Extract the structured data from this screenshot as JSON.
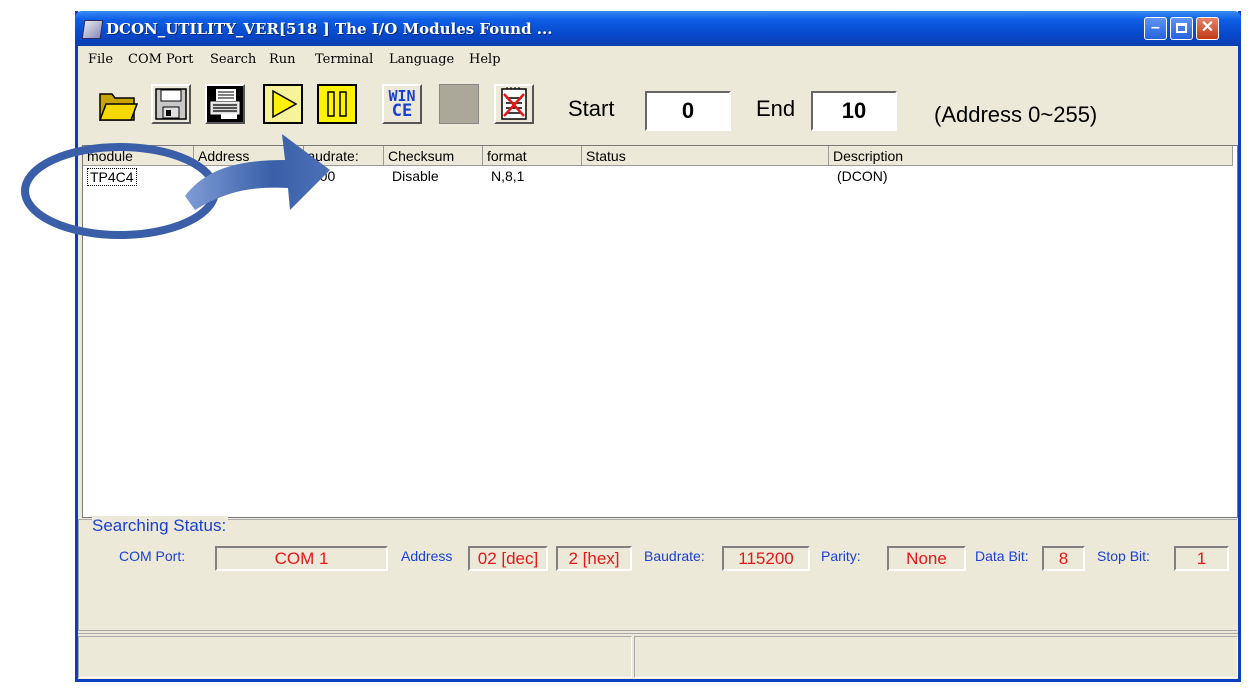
{
  "window": {
    "title": "DCON_UTILITY_VER[518 ] The I/O Modules Found ..."
  },
  "menu": [
    "File",
    "COM Port",
    "Search",
    "Run",
    "Terminal",
    "Language",
    "Help"
  ],
  "toolbar": {
    "start_label": "Start",
    "start_value": "0",
    "end_label": "End",
    "end_value": "10",
    "range_note": "(Address 0~255)",
    "wince_top": "WIN",
    "wince_bottom": "CE"
  },
  "table": {
    "columns": [
      "module",
      "Address",
      "Baudrate:",
      "Checksum",
      "format",
      "Status",
      "Description"
    ],
    "rows": [
      {
        "module": "TP4C4",
        "address": "",
        "baudrate": "...00",
        "checksum": "Disable",
        "format": "N,8,1",
        "status": "",
        "description": "(DCON)"
      }
    ]
  },
  "searching_status": {
    "legend": "Searching Status:",
    "com_port_label": "COM Port:",
    "com_port_value": "COM 1",
    "address_label": "Address",
    "address_dec": "02 [dec]",
    "address_hex": "2 [hex]",
    "baudrate_label": "Baudrate:",
    "baudrate_value": "115200",
    "parity_label": "Parity:",
    "parity_value": "None",
    "databit_label": "Data Bit:",
    "databit_value": "8",
    "stopbit_label": "Stop Bit:",
    "stopbit_value": "1"
  },
  "colors": {
    "titlebar": "#0747c9",
    "label_blue": "#1a3fd6",
    "value_red": "#e61717",
    "annotation": "#3a5fa8"
  }
}
